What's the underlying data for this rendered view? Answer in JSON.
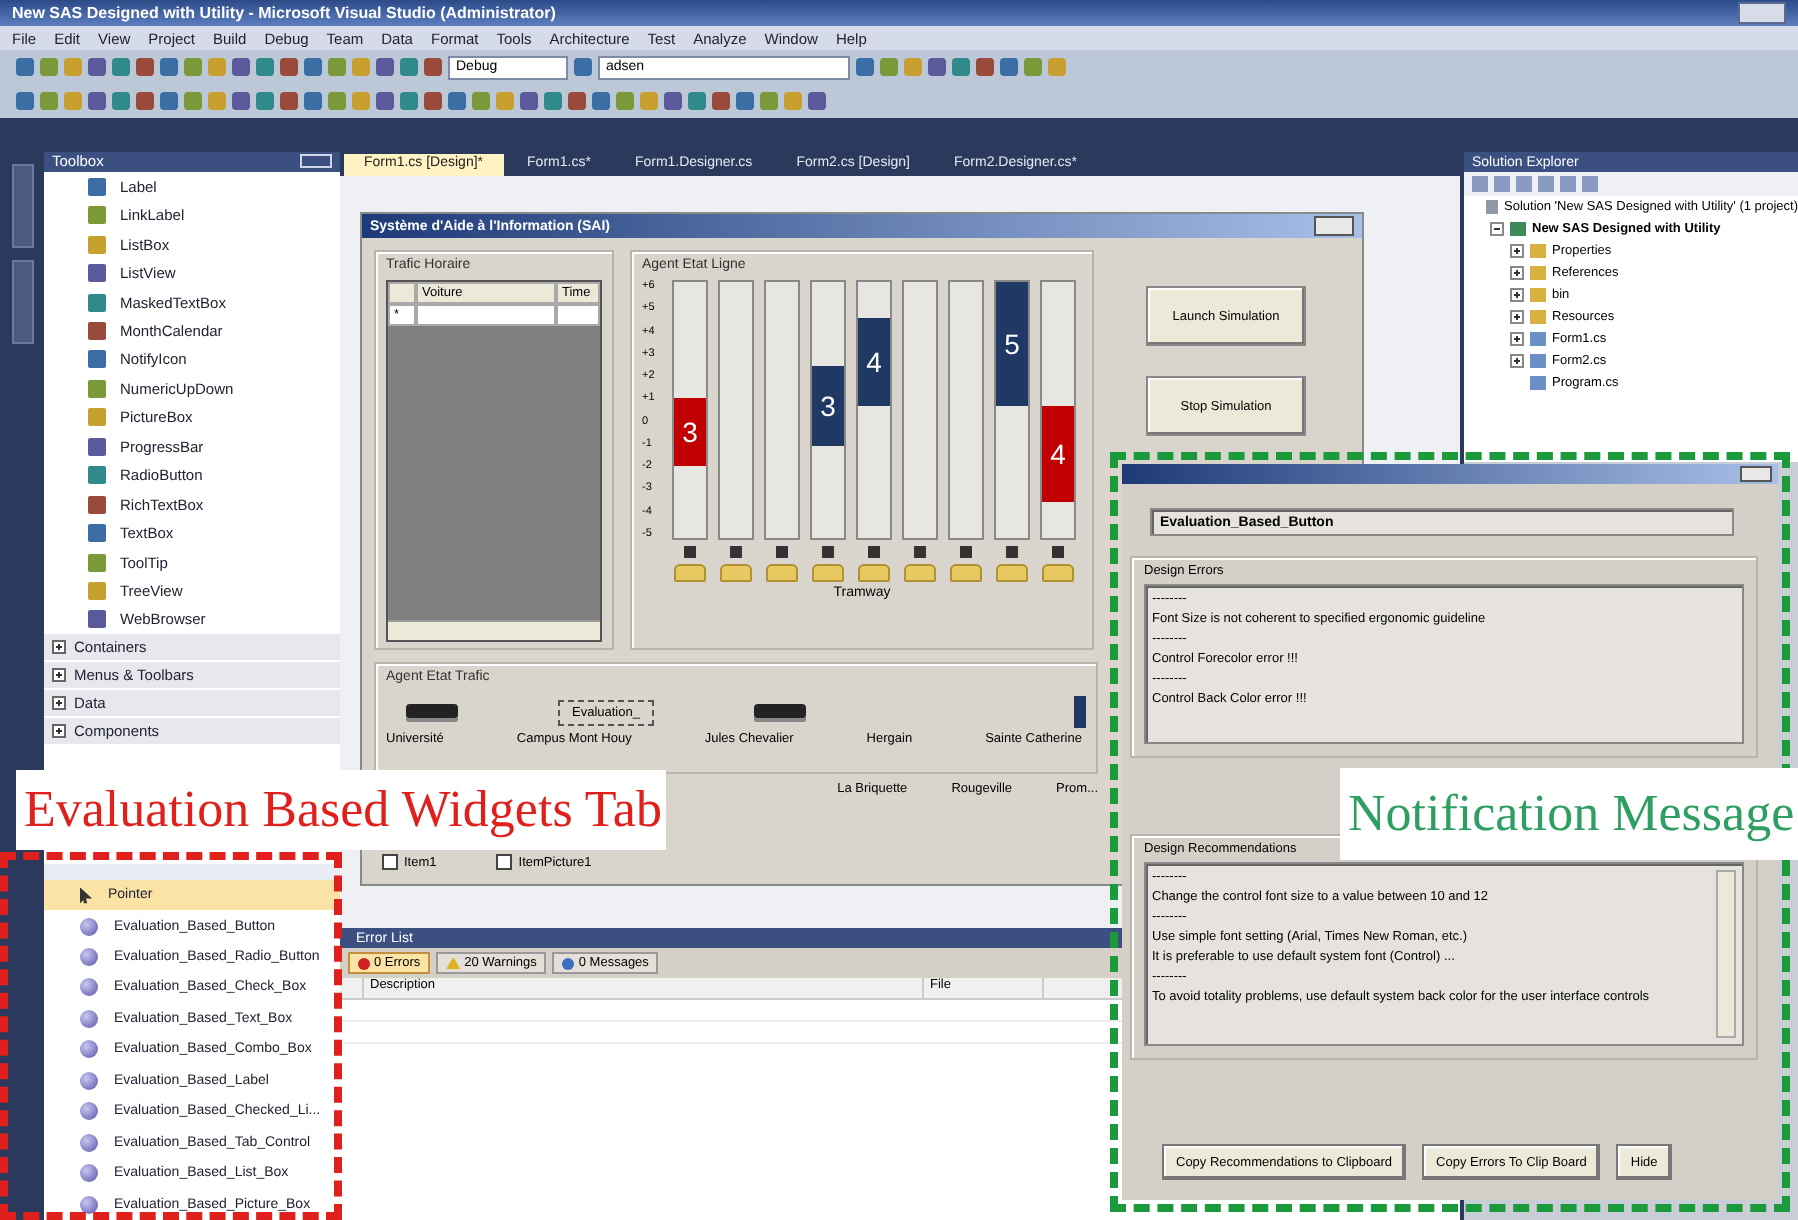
{
  "window": {
    "title": "New SAS Designed with Utility - Microsoft Visual Studio (Administrator)"
  },
  "menu": [
    "File",
    "Edit",
    "View",
    "Project",
    "Build",
    "Debug",
    "Team",
    "Data",
    "Format",
    "Tools",
    "Architecture",
    "Test",
    "Analyze",
    "Window",
    "Help"
  ],
  "toolbar": {
    "configuration": "Debug",
    "search": "adsen"
  },
  "toolbox": {
    "title": "Toolbox",
    "items": [
      "Label",
      "LinkLabel",
      "ListBox",
      "ListView",
      "MaskedTextBox",
      "MonthCalendar",
      "NotifyIcon",
      "NumericUpDown",
      "PictureBox",
      "ProgressBar",
      "RadioButton",
      "RichTextBox",
      "TextBox",
      "ToolTip",
      "TreeView",
      "WebBrowser"
    ],
    "categories": [
      {
        "label": "Containers",
        "expanded": false
      },
      {
        "label": "Menus & Toolbars",
        "expanded": false
      },
      {
        "label": "Data",
        "expanded": false
      },
      {
        "label": "Components",
        "expanded": false
      }
    ]
  },
  "widgets_toolbox": {
    "items": [
      {
        "label": "Pointer",
        "kind": "pointer",
        "selected": true
      },
      {
        "label": "Evaluation_Based_Button",
        "kind": "widget",
        "selected": false
      },
      {
        "label": "Evaluation_Based_Radio_Button",
        "kind": "widget",
        "selected": false
      },
      {
        "label": "Evaluation_Based_Check_Box",
        "kind": "widget",
        "selected": false
      },
      {
        "label": "Evaluation_Based_Text_Box",
        "kind": "widget",
        "selected": false
      },
      {
        "label": "Evaluation_Based_Combo_Box",
        "kind": "widget",
        "selected": false
      },
      {
        "label": "Evaluation_Based_Label",
        "kind": "widget",
        "selected": false
      },
      {
        "label": "Evaluation_Based_Checked_Li...",
        "kind": "widget",
        "selected": false
      },
      {
        "label": "Evaluation_Based_Tab_Control",
        "kind": "widget",
        "selected": false
      },
      {
        "label": "Evaluation_Based_List_Box",
        "kind": "widget",
        "selected": false
      },
      {
        "label": "Evaluation_Based_Picture_Box",
        "kind": "widget",
        "selected": false
      }
    ]
  },
  "document_tabs": [
    {
      "label": "Form1.cs [Design]*",
      "selected": true
    },
    {
      "label": "Form1.cs*",
      "selected": false
    },
    {
      "label": "Form1.Designer.cs",
      "selected": false
    },
    {
      "label": "Form2.cs [Design]",
      "selected": false
    },
    {
      "label": "Form2.Designer.cs*",
      "selected": false
    }
  ],
  "form": {
    "title": "Système d'Aide à l'Information (SAI)",
    "traffic_history": {
      "title": "Trafic Horaire",
      "columns": [
        "Voiture",
        "Time"
      ],
      "row_marker": "*"
    },
    "line_status": {
      "title": "Agent Etat Ligne",
      "scale": [
        "+6",
        "+5",
        "+4",
        "+3",
        "+2",
        "+1",
        "0",
        "-1",
        "-2",
        "-3",
        "-4",
        "-5"
      ],
      "caption": "Tramway",
      "lanes": [
        {
          "kind": "middle",
          "label": "3",
          "color": "#c00000"
        },
        {
          "kind": "empty"
        },
        {
          "kind": "empty"
        },
        {
          "kind": "upper",
          "label": "3",
          "color": "#1f3864"
        },
        {
          "kind": "high",
          "label": "4",
          "color": "#1f3864"
        },
        {
          "kind": "empty"
        },
        {
          "kind": "empty"
        },
        {
          "kind": "top",
          "label": "5",
          "color": "#1f3864"
        },
        {
          "kind": "lower",
          "label": "4",
          "color": "#c00000"
        }
      ]
    },
    "buttons": [
      "Launch Simulation",
      "Stop Simulation"
    ],
    "traffic_status": {
      "title": "Agent Etat Trafic",
      "widget": "Evaluation_",
      "stations": [
        "Université",
        "Campus Mont Houy",
        "Jules Chevalier",
        "Hergain",
        "Sainte Catherine"
      ],
      "more_stations": [
        "La Briquette",
        "Rougeville",
        "Prom..."
      ]
    },
    "checkboxes": [
      {
        "label": "Item1",
        "checked": false
      },
      {
        "label": "ItemPicture1",
        "checked": false
      }
    ]
  },
  "error_list": {
    "title": "Error List",
    "tabs": [
      {
        "label": "0 Errors",
        "kind": "error",
        "selected": true
      },
      {
        "label": "20 Warnings",
        "kind": "warning",
        "selected": false
      },
      {
        "label": "0 Messages",
        "kind": "message",
        "selected": false
      }
    ],
    "columns": [
      "Description",
      "File"
    ]
  },
  "solution_explorer": {
    "title": "Solution Explorer",
    "tree": [
      {
        "label": "Solution 'New SAS Designed with Utility' (1 project)",
        "kind": "solution",
        "children": [
          {
            "label": "New SAS Designed with Utility",
            "kind": "project",
            "expanded": true,
            "children": [
              {
                "label": "Properties",
                "kind": "folder",
                "expanded": false
              },
              {
                "label": "References",
                "kind": "folder",
                "expanded": false
              },
              {
                "label": "bin",
                "kind": "folder",
                "expanded": false
              },
              {
                "label": "Resources",
                "kind": "folder",
                "expanded": false
              },
              {
                "label": "Form1.cs",
                "kind": "file",
                "expanded": false
              },
              {
                "label": "Form2.cs",
                "kind": "file",
                "expanded": false
              },
              {
                "label": "Program.cs",
                "kind": "file"
              }
            ]
          }
        ]
      }
    ]
  },
  "dialog": {
    "control": "Evaluation_Based_Button",
    "errors_title": "Design Errors",
    "errors": [
      "--------",
      "Font Size is not coherent to specified ergonomic guideline",
      "--------",
      "Control Forecolor error !!!",
      "--------",
      "Control Back Color error !!!"
    ],
    "recommendations_title": "Design Recommendations",
    "recommendations": [
      "--------",
      "Change the control font size to a value between 10 and 12",
      "--------",
      "Use simple font setting (Arial, Times New Roman, etc.)",
      "It is preferable to use default system font (Control) ...",
      "--------",
      "To avoid totality problems, use default system back color for the user interface controls"
    ],
    "buttons": [
      "Copy Recommendations to Clipboard",
      "Copy Errors To Clip Board",
      "Hide"
    ]
  },
  "annotations": [
    {
      "kind": "widgets",
      "text": "Evaluation Based Widgets Tab",
      "color": "#e0201c"
    },
    {
      "kind": "notification",
      "text": "Notification Message",
      "color": "#2e9e62"
    }
  ]
}
